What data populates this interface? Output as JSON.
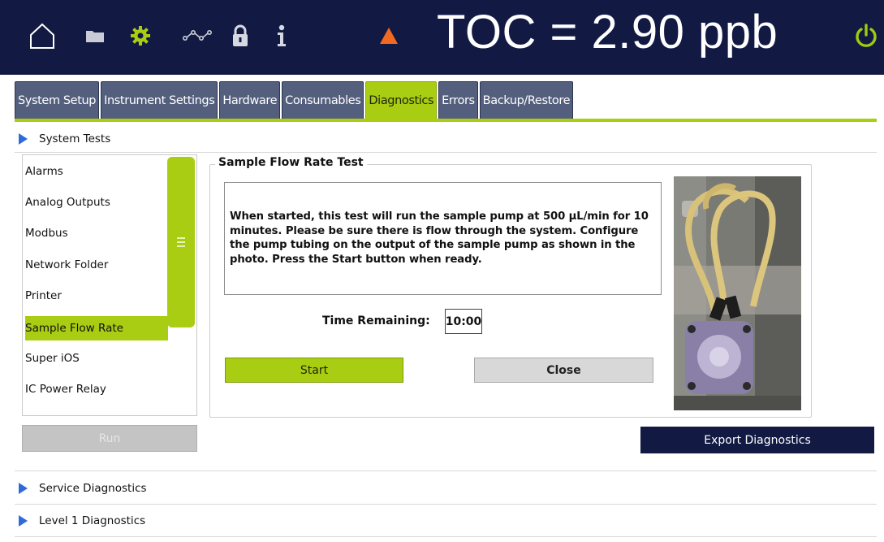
{
  "header": {
    "toc_reading": "TOC = 2.90 ppb",
    "icons": [
      "home-icon",
      "folder-icon",
      "gear-icon",
      "trend-icon",
      "lock-icon",
      "info-icon",
      "warning-icon",
      "power-icon"
    ],
    "colors": {
      "bar": "#121a44",
      "accent": "#a9cd12",
      "power": "#9ccc10",
      "warning": "#f26a21"
    }
  },
  "tabs": [
    {
      "label": "System Setup",
      "active": false
    },
    {
      "label": "Instrument Settings",
      "active": false
    },
    {
      "label": "Hardware",
      "active": false
    },
    {
      "label": "Consumables",
      "active": false
    },
    {
      "label": "Diagnostics",
      "active": true
    },
    {
      "label": "Errors",
      "active": false
    },
    {
      "label": "Backup/Restore",
      "active": false
    }
  ],
  "sections": {
    "system_tests": "System Tests",
    "service_diagnostics": "Service Diagnostics",
    "level1_diagnostics": "Level 1 Diagnostics"
  },
  "test_list": {
    "items": [
      "Alarms",
      "Analog Outputs",
      "Modbus",
      "Network Folder",
      "Printer",
      "Sample Flow Rate",
      "Super iOS",
      "IC Power Relay"
    ],
    "selected": "Sample Flow Rate"
  },
  "panel": {
    "title": "Sample Flow Rate Test",
    "description": "When started, this test will run the sample pump at 500 µL/min for 10 minutes. Please be sure there is flow through the system. Configure the pump tubing on the output of the sample pump as shown in the photo. Press the Start button when ready.",
    "time_remaining_label": "Time Remaining:",
    "time_remaining_value": "10:00",
    "start_label": "Start",
    "close_label": "Close"
  },
  "buttons": {
    "run_label": "Run",
    "export_label": "Export Diagnostics"
  }
}
